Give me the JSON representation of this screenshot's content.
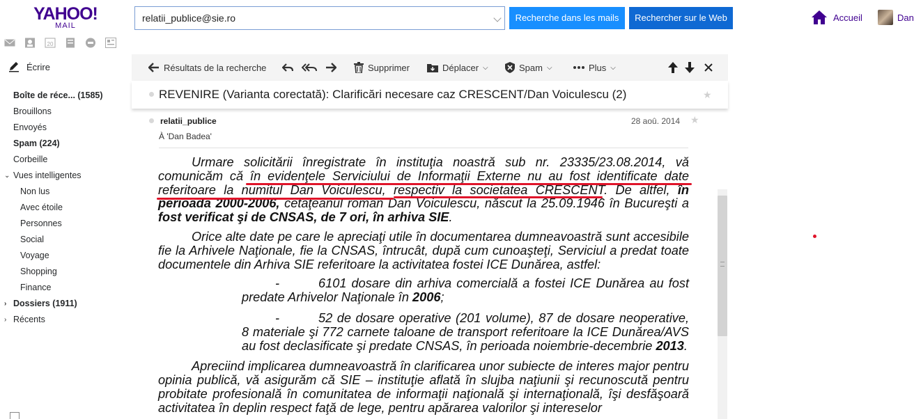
{
  "header": {
    "logo_main": "YAHOO!",
    "logo_sub": "MAIL",
    "search_value": "relatii_publice@sie.ro",
    "btn_search_mail": "Recherche dans les mails",
    "btn_search_web": "Rechercher sur le Web",
    "home_label": "Accueil",
    "user_name": "Dan"
  },
  "nav": {
    "compose": "Écrire",
    "items": [
      {
        "label": "Boîte de réce... (1585)",
        "bold": true
      },
      {
        "label": "Brouillons"
      },
      {
        "label": "Envoyés"
      },
      {
        "label": "Spam (224)",
        "bold": true
      },
      {
        "label": "Corbeille"
      },
      {
        "label": "Vues intelligentes"
      },
      {
        "label": "Non lus"
      },
      {
        "label": "Avec étoile"
      },
      {
        "label": "Personnes"
      },
      {
        "label": "Social"
      },
      {
        "label": "Voyage"
      },
      {
        "label": "Shopping"
      },
      {
        "label": "Finance"
      },
      {
        "label": "Dossiers (1911)",
        "bold": true
      },
      {
        "label": "Récents"
      }
    ]
  },
  "toolbar": {
    "back": "Résultats de la recherche",
    "delete": "Supprimer",
    "move": "Déplacer",
    "spam": "Spam",
    "more": "Plus"
  },
  "message": {
    "subject": "REVENIRE (Varianta corectată): Clarificări necesare caz CRESCENT/Dan Voiculescu (2)",
    "sender": "relatii_publice",
    "date": "28 aoû. 2014",
    "to": "À  'Dan Badea'",
    "p1a": "Urmare solicitării înregistrate în instituţia noastră sub nr. 23335/23.08.2014, vă comunicăm că în evidenţele Serviciului de Informaţii Externe nu au fost identificate date referitoare la numitul Dan Voiculescu, respectiv la societatea CRESCENT. De altfel, ",
    "p1b": "în perioada 2000-2006,",
    "p1c": " cetăţeanul român Dan Voiculescu, născut la 25.09.1946 în Bucureşti a ",
    "p1d": "fost verificat şi de CNSAS, de 7 ori, în arhiva SIE",
    "p1e": ".",
    "p2": "Orice alte date pe care le apreciaţi utile în documentarea dumneavoastră sunt accesibile fie la Arhivele Naţionale, fie la CNSAS, întrucât, după cum cunoaşteţi, Serviciul a predat toate documentele din Arhiva SIE referitoare la activitatea fostei ICE Dunărea, astfel:",
    "li1a": "6101 dosare din arhiva comercială a fostei ICE Dunărea au fost predate Arhivelor Naţionale în ",
    "li1b": "2006",
    "li1c": ";",
    "li2a": "52 de dosare operative (201 volume), 87 de dosare neoperative, 8 materiale şi 772 carnete taloane de transport referitoare la ICE Dunărea/AVS au fost declasificate şi predate CNSAS, în perioada noiembrie-decembrie ",
    "li2b": "2013",
    "li2c": ".",
    "p3": "Apreciind implicarea dumneavoastră în clarificarea unor subiecte de interes major pentru opinia publică, vă asigurăm că  SIE – instituţie aflată în slujba naţiunii şi recunoscută pentru probitate profesională în comunitatea de informaţii naţională şi internaţională,  îşi desfăşoară activitatea în deplin respect faţă de lege, pentru apărarea valorilor şi intereselor"
  },
  "colors": {
    "yahoo_purple": "#400090",
    "btn_mail": "#188fff",
    "btn_web": "#0f69d3",
    "underline_red": "#e0142a"
  }
}
